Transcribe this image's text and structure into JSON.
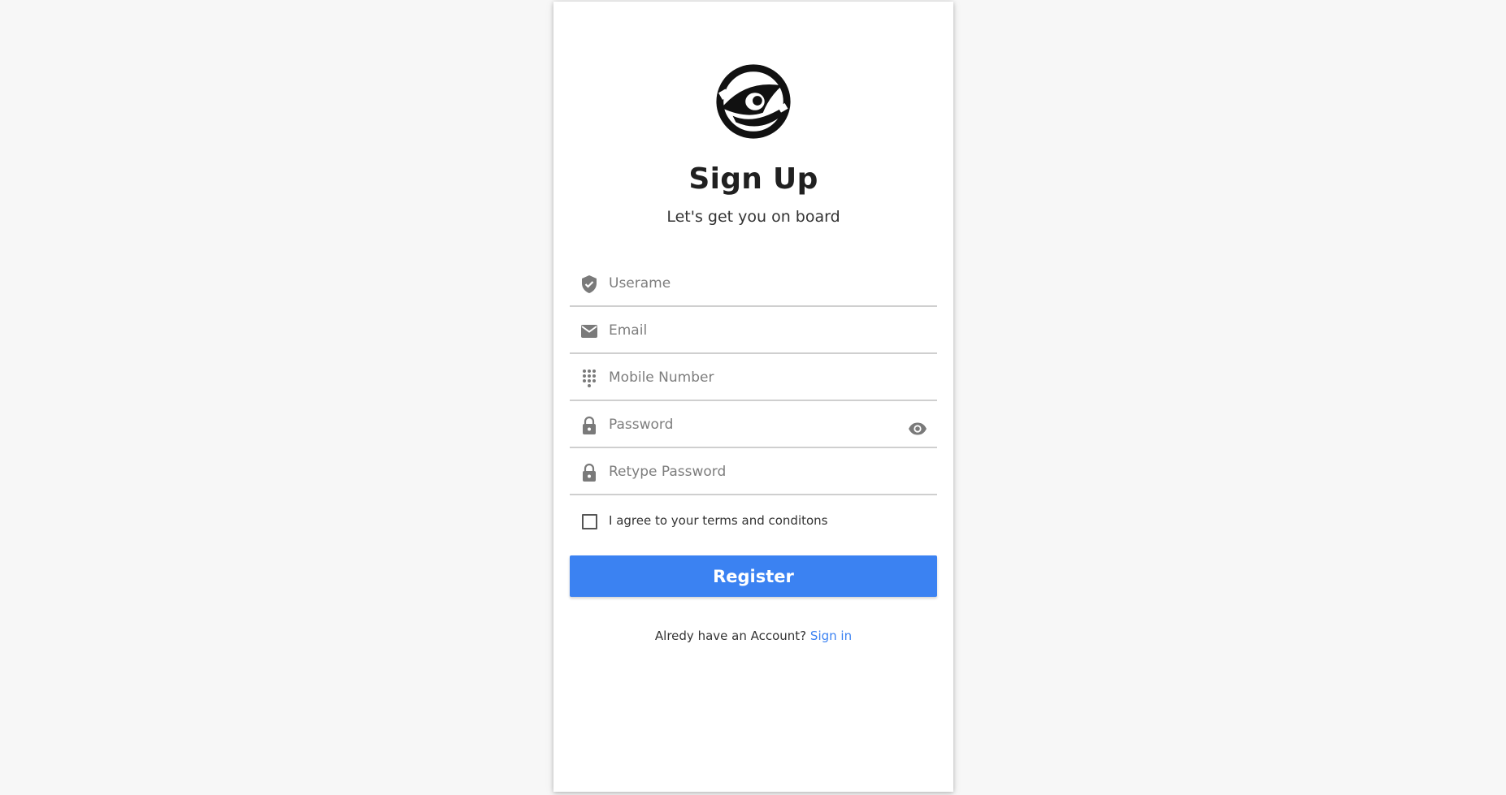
{
  "header": {
    "title": "Sign Up",
    "subtitle": "Let's get you on board"
  },
  "form": {
    "username": {
      "placeholder": "Userame",
      "value": "",
      "icon": "shield-check-icon"
    },
    "email": {
      "placeholder": "Email",
      "value": "",
      "icon": "mail-icon"
    },
    "mobile": {
      "placeholder": "Mobile Number",
      "value": "",
      "icon": "dialpad-icon"
    },
    "password": {
      "placeholder": "Password",
      "value": "",
      "icon": "lock-icon",
      "toggle_icon": "eye-icon"
    },
    "retype_password": {
      "placeholder": "Retype Password",
      "value": "",
      "icon": "lock-icon"
    },
    "terms": {
      "label": "I agree to your terms and conditons",
      "checked": false
    },
    "register_label": "Register"
  },
  "footer": {
    "prompt": "Alredy have an Account?",
    "link_label": "Sign in"
  },
  "colors": {
    "accent": "#3b82f2",
    "background": "#f7f7f7",
    "card": "#ffffff",
    "icon": "#7a7a7a"
  }
}
